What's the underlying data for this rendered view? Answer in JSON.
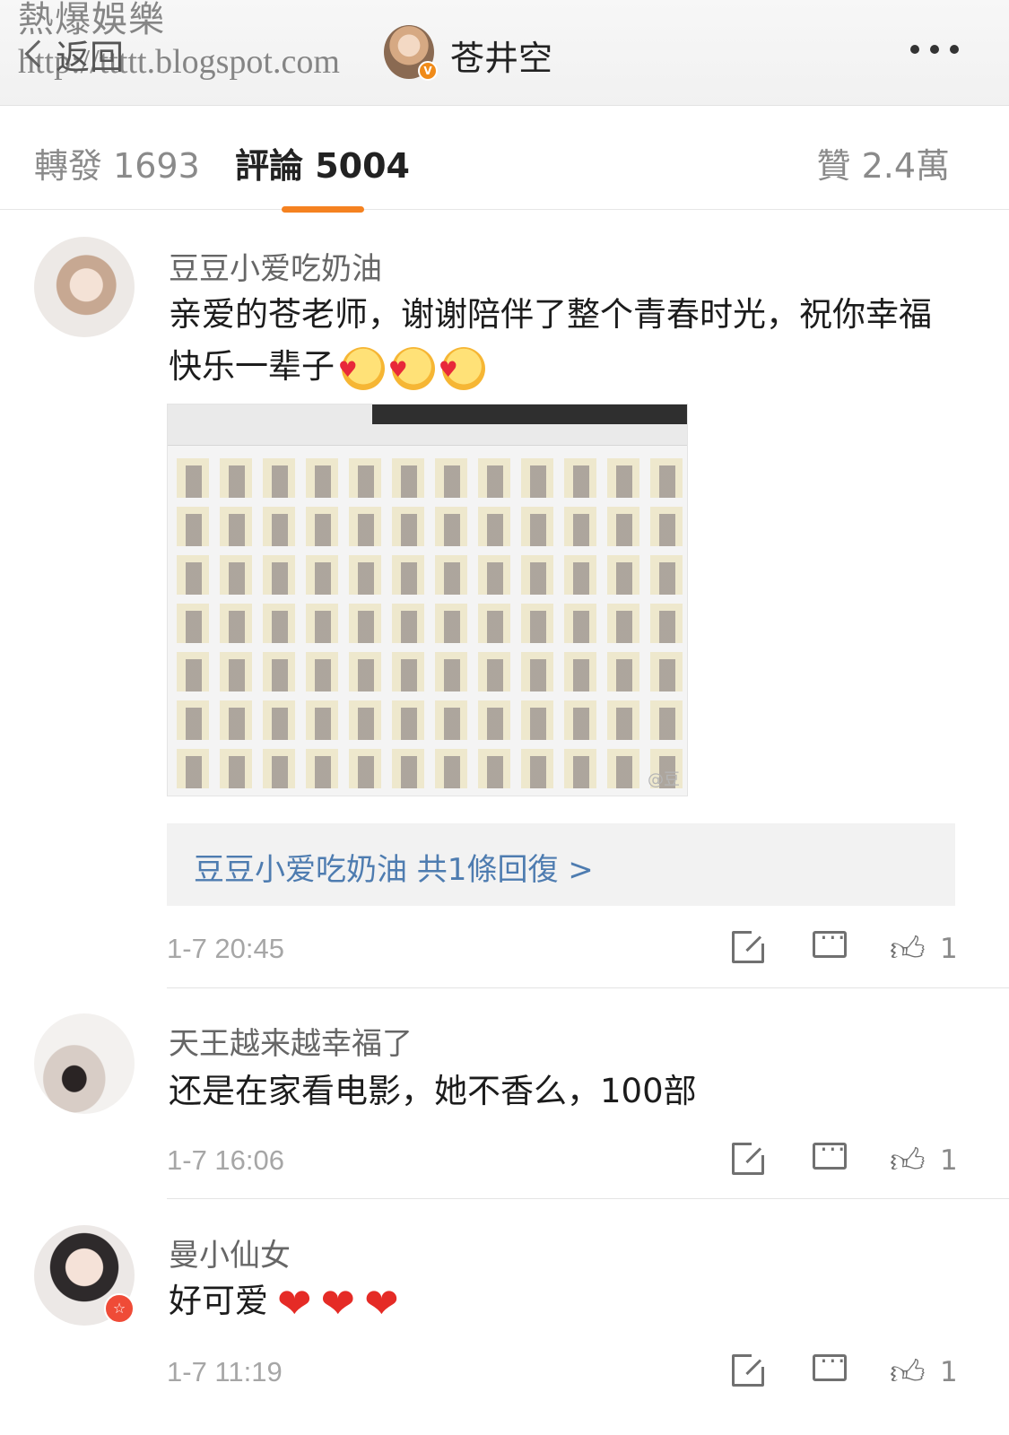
{
  "watermark": {
    "name": "熱爆娛樂",
    "url": "http://ttttt.blogspot.com"
  },
  "nav": {
    "back_label": "返回",
    "title": "苍井空",
    "more_icon": "ellipsis-icon"
  },
  "tabs": [
    {
      "label": "轉發 1693"
    },
    {
      "label": "評論 5004"
    },
    {
      "label": "贊 2.4萬"
    }
  ],
  "accent_color": "#f58220",
  "link_color": "#4e7cb0",
  "comments": [
    {
      "user": "豆豆小爱吃奶油",
      "text": "亲爱的苍老师，谢谢陪伴了整个青春时光，祝你幸福快乐一辈子",
      "emoji_count": 3,
      "image_watermark": "@豆",
      "reply_summary": "豆豆小爱吃奶油  共1條回復 >",
      "time": "1-7 20:45",
      "likes": "1"
    },
    {
      "user": "天王越来越幸福了",
      "text": "还是在家看电影，她不香么，100部",
      "time": "1-7 16:06",
      "likes": "1"
    },
    {
      "user": "曼小仙女",
      "text": "好可爱",
      "hearts": 3,
      "time": "1-7 11:19",
      "likes": "1"
    }
  ]
}
